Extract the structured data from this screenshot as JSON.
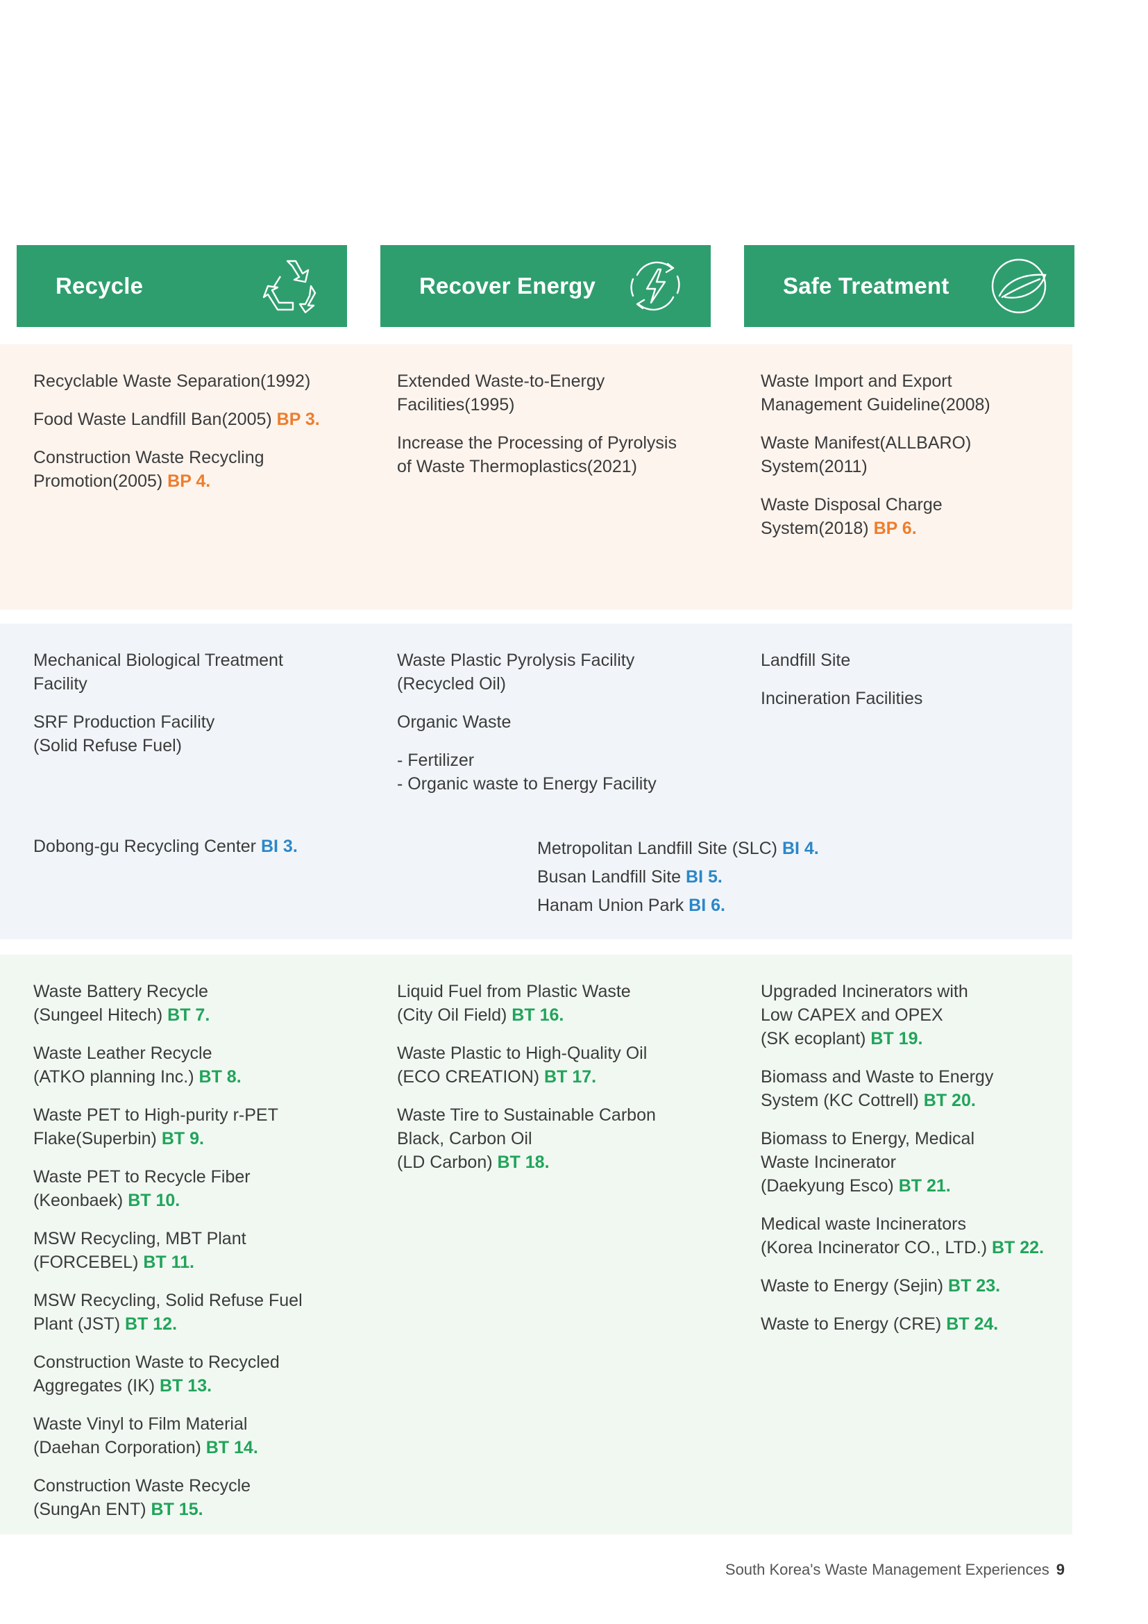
{
  "headers": [
    {
      "title": "Recycle",
      "icon": "recycle-icon"
    },
    {
      "title": "Recover Energy",
      "icon": "energy-recovery-icon"
    },
    {
      "title": "Safe Treatment",
      "icon": "leaf-icon"
    }
  ],
  "policies": {
    "recycle": [
      {
        "text": "Recyclable Waste Separation(1992)",
        "tag": ""
      },
      {
        "text": "Food Waste Landfill Ban(2005) ",
        "tag": "BP 3."
      },
      {
        "text": "Construction Waste Recycling\nPromotion(2005) ",
        "tag": "BP 4."
      }
    ],
    "energy": [
      {
        "text": "Extended Waste-to-Energy\nFacilities(1995)",
        "tag": ""
      },
      {
        "text": "Increase the Processing of Pyrolysis\nof Waste Thermoplastics(2021)",
        "tag": ""
      }
    ],
    "treatment": [
      {
        "text": "Waste Import and Export\nManagement Guideline(2008)",
        "tag": ""
      },
      {
        "text": "Waste Manifest(ALLBARO)\nSystem(2011)",
        "tag": ""
      },
      {
        "text": "Waste Disposal Charge\nSystem(2018) ",
        "tag": "BP 6."
      }
    ]
  },
  "infrastructure": {
    "recycle": [
      {
        "text": "Mechanical Biological Treatment\nFacility",
        "tag": ""
      },
      {
        "text": "SRF Production Facility\n(Solid Refuse Fuel)",
        "tag": ""
      }
    ],
    "energy": [
      {
        "text": "Waste Plastic Pyrolysis Facility\n(Recycled Oil)",
        "tag": ""
      },
      {
        "text": "Organic Waste",
        "tag": ""
      },
      {
        "text": "- Fertilizer\n- Organic waste to Energy Facility",
        "tag": ""
      }
    ],
    "treatment": [
      {
        "text": "Landfill Site",
        "tag": ""
      },
      {
        "text": "Incineration Facilities",
        "tag": ""
      }
    ],
    "examples_left": [
      {
        "text": "Dobong-gu Recycling Center ",
        "tag": "BI 3."
      }
    ],
    "examples_right": [
      {
        "text": "Metropolitan Landfill Site (SLC) ",
        "tag": "BI 4."
      },
      {
        "text": "Busan Landfill Site ",
        "tag": "BI 5."
      },
      {
        "text": "Hanam Union Park ",
        "tag": "BI 6."
      }
    ]
  },
  "technologies": {
    "recycle": [
      {
        "text": "Waste Battery Recycle\n(Sungeel Hitech) ",
        "tag": "BT 7."
      },
      {
        "text": "Waste Leather Recycle\n(ATKO planning Inc.) ",
        "tag": "BT 8."
      },
      {
        "text": "Waste PET to High-purity r-PET\nFlake(Superbin) ",
        "tag": "BT 9."
      },
      {
        "text": "Waste PET to Recycle Fiber\n(Keonbaek) ",
        "tag": "BT 10."
      },
      {
        "text": "MSW Recycling, MBT Plant\n(FORCEBEL) ",
        "tag": "BT 11."
      },
      {
        "text": "MSW Recycling, Solid Refuse Fuel\nPlant (JST) ",
        "tag": "BT 12."
      },
      {
        "text": "Construction Waste to Recycled\nAggregates (IK) ",
        "tag": "BT 13."
      },
      {
        "text": "Waste Vinyl to Film Material\n(Daehan Corporation) ",
        "tag": "BT 14."
      },
      {
        "text": "Construction Waste Recycle\n(SungAn ENT) ",
        "tag": "BT 15."
      }
    ],
    "energy": [
      {
        "text": "Liquid Fuel from Plastic Waste\n(City Oil Field) ",
        "tag": "BT 16."
      },
      {
        "text": "Waste Plastic to High-Quality Oil\n(ECO CREATION) ",
        "tag": "BT 17."
      },
      {
        "text": "Waste Tire to Sustainable Carbon\nBlack, Carbon Oil\n(LD Carbon) ",
        "tag": "BT 18."
      }
    ],
    "treatment": [
      {
        "text": "Upgraded Incinerators with\nLow CAPEX and OPEX\n(SK ecoplant) ",
        "tag": "BT 19."
      },
      {
        "text": "Biomass and Waste to Energy\nSystem (KC Cottrell) ",
        "tag": "BT 20."
      },
      {
        "text": "Biomass to Energy, Medical\nWaste Incinerator\n(Daekyung Esco) ",
        "tag": "BT 21."
      },
      {
        "text": "Medical waste Incinerators\n(Korea Incinerator CO., LTD.) ",
        "tag": "BT 22."
      },
      {
        "text": "Waste to Energy (Sejin) ",
        "tag": "BT  23."
      },
      {
        "text": "Waste to Energy (CRE) ",
        "tag": "BT 24."
      }
    ]
  },
  "footer": {
    "title": "South Korea's Waste Management Experiences",
    "page": "9"
  },
  "colors": {
    "header_green": "#2f9e6f",
    "policy_bg": "#fdf4ee",
    "infra_bg": "#f1f5f9",
    "tech_bg": "#f1f8f2",
    "tag_bp": "#ee7d2b",
    "tag_bi": "#2b87c8",
    "tag_bt": "#21a45a"
  }
}
